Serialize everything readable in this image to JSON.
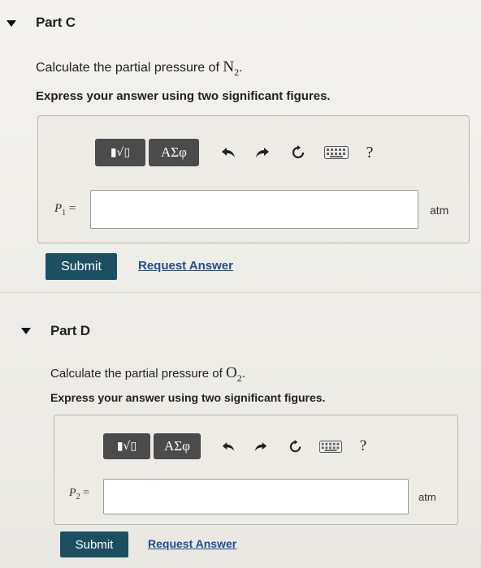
{
  "partC": {
    "title": "Part C",
    "prompt_prefix": "Calculate the partial pressure of ",
    "chem_symbol": "N",
    "chem_sub": "2",
    "prompt_suffix": ".",
    "instruction": "Express your answer using two significant figures.",
    "toolbar": {
      "template_label": "▮√▯",
      "greek_label": "ΑΣφ",
      "help_label": "?"
    },
    "var_symbol": "P",
    "var_sub": "1",
    "var_eq": " =",
    "answer_value": "",
    "unit": "atm",
    "submit_label": "Submit",
    "request_label": "Request Answer"
  },
  "partD": {
    "title": "Part D",
    "prompt_prefix": "Calculate the partial pressure of ",
    "chem_symbol": "O",
    "chem_sub": "2",
    "prompt_suffix": ".",
    "instruction": "Express your answer using two significant figures.",
    "toolbar": {
      "template_label": "▮√▯",
      "greek_label": "ΑΣφ",
      "help_label": "?"
    },
    "var_symbol": "P",
    "var_sub": "2",
    "var_eq": " =",
    "answer_value": "",
    "unit": "atm",
    "submit_label": "Submit",
    "request_label": "Request Answer"
  },
  "icons": {
    "collapse": "caret-down-icon",
    "undo": "undo-icon",
    "redo": "redo-icon",
    "reset": "reset-icon",
    "keyboard": "keyboard-icon",
    "help": "help-icon"
  }
}
